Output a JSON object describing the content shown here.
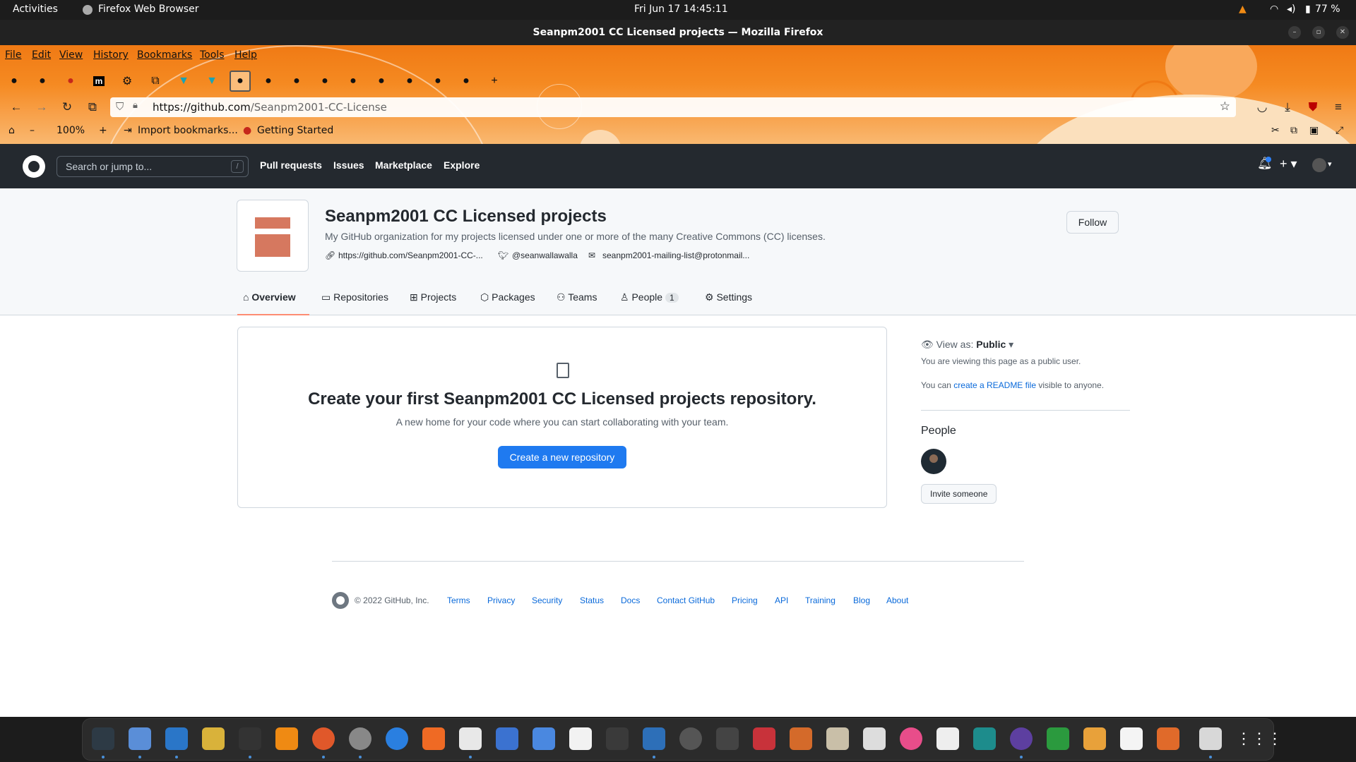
{
  "gnome": {
    "activities": "Activities",
    "app": "Firefox Web Browser",
    "clock": "Fri Jun 17  14:45:11",
    "battery": "77 %"
  },
  "window": {
    "title": "Seanpm2001 CC Licensed projects — Mozilla Firefox"
  },
  "menu": {
    "file": "File",
    "edit": "Edit",
    "view": "View",
    "history": "History",
    "bookmarks": "Bookmarks",
    "tools": "Tools",
    "help": "Help"
  },
  "url": {
    "host": "https://github.com",
    "path": "/Seanpm2001-CC-License"
  },
  "bookmarks": {
    "zoom": "100%",
    "import": "Import bookmarks...",
    "getting_started": "Getting Started"
  },
  "github": {
    "search_placeholder": "Search or jump to...",
    "slash": "/",
    "nav": {
      "pulls": "Pull requests",
      "issues": "Issues",
      "marketplace": "Marketplace",
      "explore": "Explore"
    }
  },
  "org": {
    "name": "Seanpm2001 CC Licensed projects",
    "description": "My GitHub organization for my projects licensed under one or more of the many Creative Commons (CC) licenses.",
    "website": "https://github.com/Seanpm2001-CC-...",
    "twitter": "@seanwallawalla",
    "email": "seanpm2001-mailing-list@protonmail...",
    "follow": "Follow"
  },
  "tabs": {
    "overview": "Overview",
    "repositories": "Repositories",
    "projects": "Projects",
    "packages": "Packages",
    "teams": "Teams",
    "people": "People",
    "people_count": "1",
    "settings": "Settings"
  },
  "blankslate": {
    "title": "Create your first Seanpm2001 CC Licensed projects repository.",
    "text": "A new home for your code where you can start collaborating with your team.",
    "button": "Create a new repository"
  },
  "sidebar": {
    "view_as_label": "View as:",
    "view_as_value": "Public",
    "viewing": "You are viewing this page as a public user.",
    "readme_prefix": "You can",
    "readme_link": "create a README file",
    "readme_suffix": "visible to anyone.",
    "people_title": "People",
    "invite": "Invite someone"
  },
  "footer": {
    "copyright": "© 2022 GitHub, Inc.",
    "links": [
      "Terms",
      "Privacy",
      "Security",
      "Status",
      "Docs",
      "Contact GitHub",
      "Pricing",
      "API",
      "Training",
      "Blog",
      "About"
    ]
  },
  "colors": {
    "firefox_orange": "#f58a22",
    "github_header": "#24292f",
    "primary_button": "#1f7af0",
    "tab_underline": "#fd8c73",
    "link": "#0969da"
  }
}
